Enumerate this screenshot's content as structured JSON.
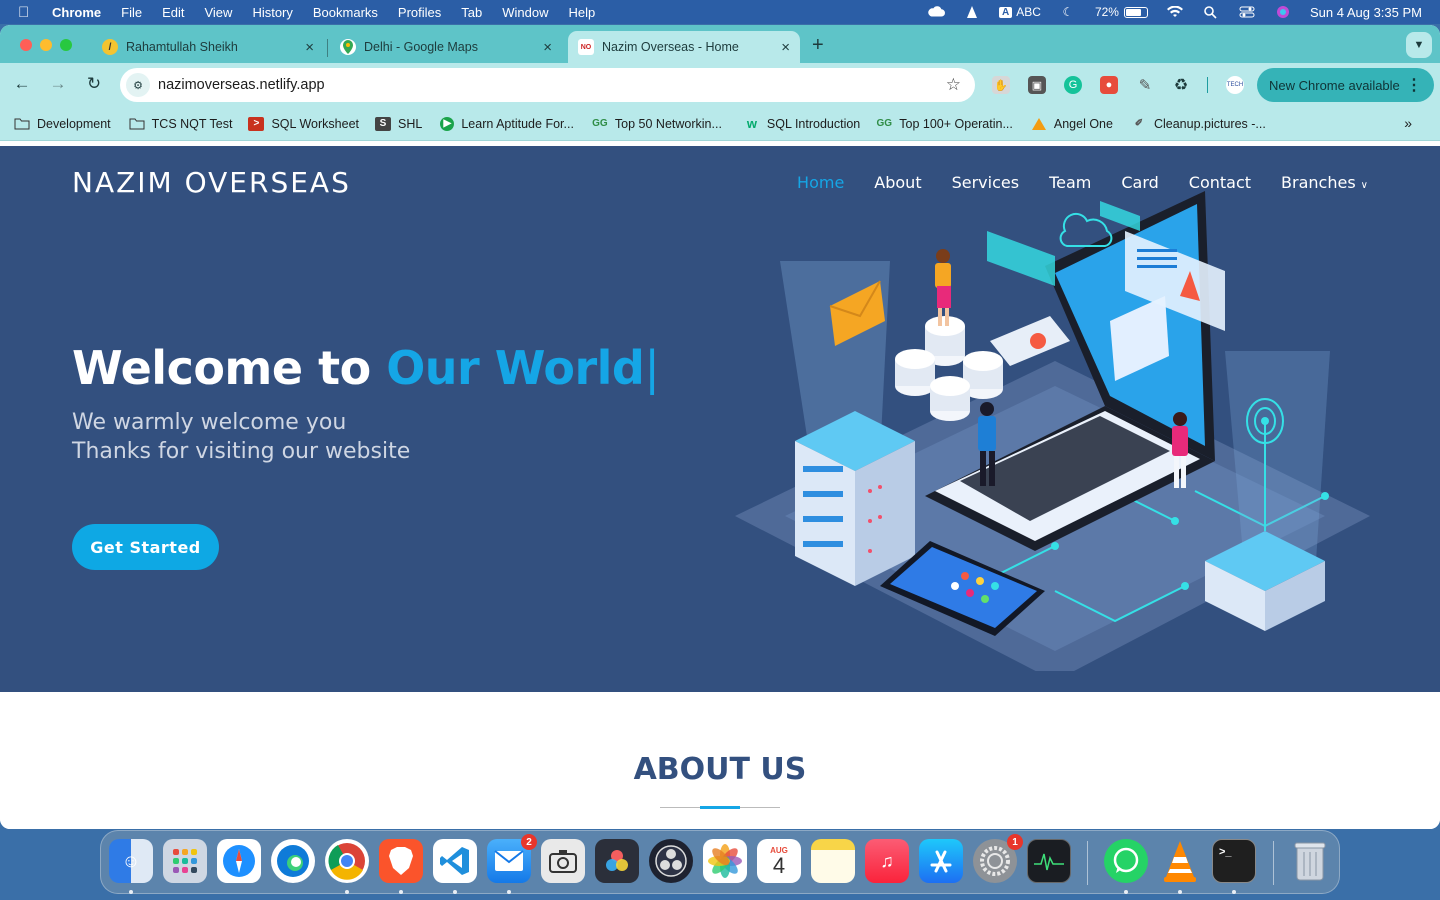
{
  "menubar": {
    "app_name": "Chrome",
    "items": [
      "File",
      "Edit",
      "View",
      "History",
      "Bookmarks",
      "Profiles",
      "Tab",
      "Window",
      "Help"
    ],
    "input_source": "ABC",
    "battery": "72%",
    "datetime": "Sun 4 Aug  3:35 PM"
  },
  "browser": {
    "tabs": [
      {
        "title": "Rahamtullah Sheikh",
        "icon": "yellow-circle-icon"
      },
      {
        "title": "Delhi - Google Maps",
        "icon": "google-maps-icon"
      },
      {
        "title": "Nazim Overseas - Home",
        "icon": "nazim-logo-icon",
        "active": true
      }
    ],
    "url": "nazimoverseas.netlify.app",
    "update_button": "New Chrome available",
    "bookmarks": [
      {
        "label": "Development",
        "icon": "folder-icon"
      },
      {
        "label": "TCS NQT Test",
        "icon": "folder-icon"
      },
      {
        "label": "SQL Worksheet",
        "icon": "sql-worksheet-icon"
      },
      {
        "label": "SHL",
        "icon": "shl-icon"
      },
      {
        "label": "Learn Aptitude For...",
        "icon": "learn-aptitude-icon"
      },
      {
        "label": "Top 50 Networkin...",
        "icon": "gfg-icon"
      },
      {
        "label": "SQL Introduction",
        "icon": "w3schools-icon"
      },
      {
        "label": "Top 100+ Operatin...",
        "icon": "gfg-icon"
      },
      {
        "label": "Angel One",
        "icon": "angel-one-icon"
      },
      {
        "label": "Cleanup.pictures -...",
        "icon": "cleanup-icon"
      }
    ]
  },
  "site": {
    "brand": "NAZIM OVERSEAS",
    "nav": [
      "Home",
      "About",
      "Services",
      "Team",
      "Card",
      "Contact",
      "Branches"
    ],
    "headline_prefix": "Welcome to ",
    "headline_accent": "Our World",
    "headline_cursor": "|",
    "subtitle_line1": "We warmly welcome you",
    "subtitle_line2": "Thanks for visiting our website",
    "cta": "Get Started",
    "about_title": "ABOUT US"
  },
  "dock": {
    "apps": [
      "Finder",
      "Launchpad",
      "Safari",
      "Edge",
      "Chrome",
      "Brave",
      "VS Code",
      "Mail",
      "Screenshot",
      "DaVinci Resolve",
      "OBS",
      "Photos",
      "Calendar",
      "Notes",
      "Music",
      "App Store",
      "System Settings",
      "Activity Monitor",
      "WhatsApp",
      "VLC",
      "Terminal",
      "Trash"
    ],
    "mail_badge": "2",
    "settings_badge": "1",
    "calendar_month": "AUG",
    "calendar_day": "4"
  },
  "colors": {
    "hero_bg": "#33507f",
    "accent": "#15a6e6",
    "tabbar": "#5ec4c8",
    "toolbar": "#b8e9ea"
  }
}
